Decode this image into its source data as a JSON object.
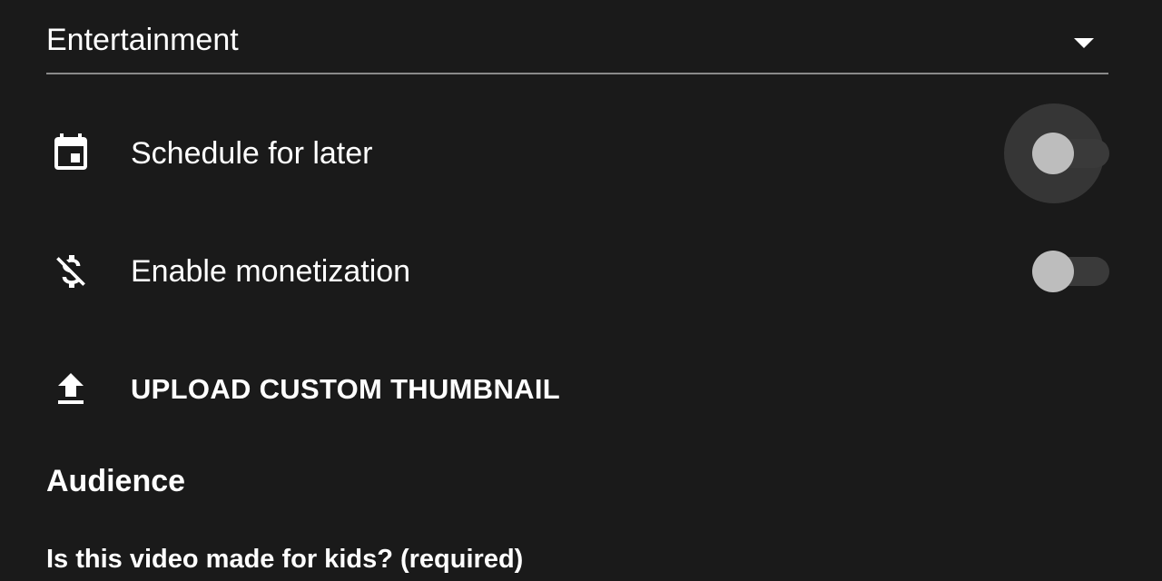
{
  "category": {
    "selected": "Entertainment"
  },
  "settings": {
    "schedule": {
      "label": "Schedule for later",
      "icon": "calendar-icon",
      "enabled": false,
      "focused": true
    },
    "monetization": {
      "label": "Enable monetization",
      "icon": "money-off-icon",
      "enabled": false,
      "focused": false
    }
  },
  "thumbnail": {
    "label": "UPLOAD CUSTOM THUMBNAIL",
    "icon": "upload-icon"
  },
  "audience": {
    "title": "Audience",
    "question": "Is this video made for kids? (required)"
  },
  "colors": {
    "background": "#1a1a1a",
    "text": "#ffffff",
    "toggle_thumb_off": "#bdbdbd",
    "toggle_track_off": "#3a3a3a"
  }
}
